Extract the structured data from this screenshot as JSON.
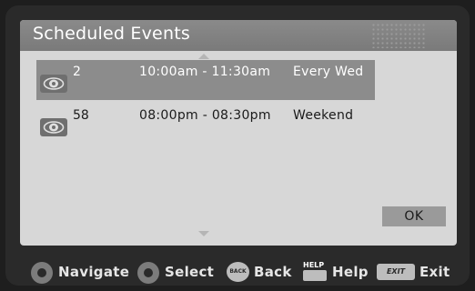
{
  "dialog": {
    "title": "Scheduled Events",
    "ok_label": "OK",
    "events": [
      {
        "channel": "2",
        "time": "10:00am - 11:30am",
        "repeat": "Every Wed",
        "icon": "eye-icon"
      },
      {
        "channel": "58",
        "time": "08:00pm - 08:30pm",
        "repeat": "Weekend",
        "icon": "eye-icon"
      }
    ]
  },
  "footer": {
    "navigate": {
      "label": "Navigate",
      "icon": "dpad-icon"
    },
    "select": {
      "label": "Select",
      "icon": "dpad-icon"
    },
    "back": {
      "label": "Back",
      "key": "BACK"
    },
    "help": {
      "label": "Help",
      "key": "HELP"
    },
    "exit": {
      "label": "Exit",
      "key": "EXIT"
    }
  },
  "colors": {
    "background": "#1e1e1e",
    "panel": "#d7d7d7",
    "title_bar": "#808080",
    "selected_row": "#8c8c8c"
  }
}
